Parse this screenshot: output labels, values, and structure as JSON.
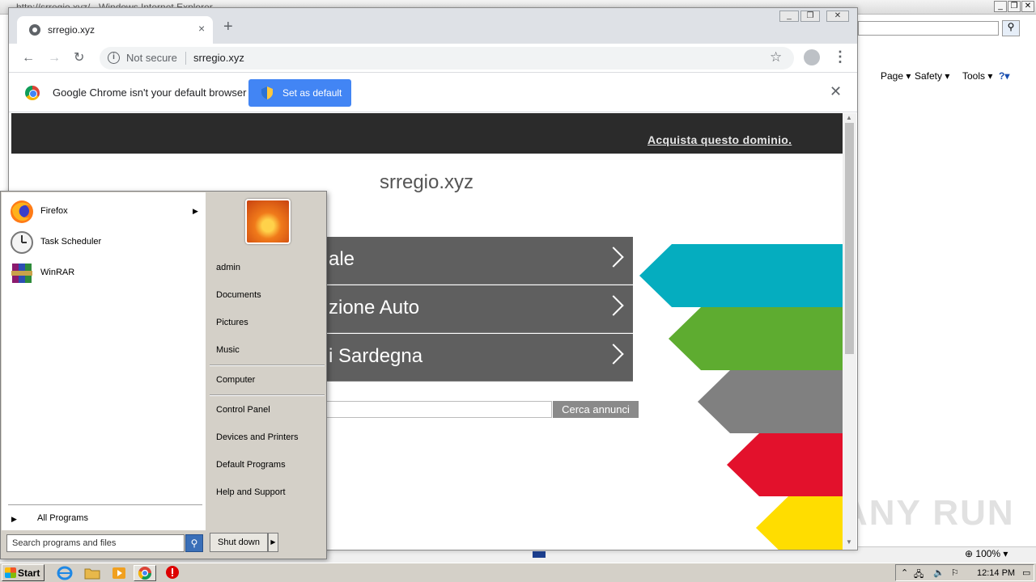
{
  "ie": {
    "title": "http://srregio.xyz/ - Windows Internet Explorer",
    "cmd_page": "Page ▾",
    "cmd_safety": "Safety ▾",
    "cmd_tools": "Tools ▾",
    "zoom": "100%"
  },
  "chrome": {
    "tab_title": "srregio.xyz",
    "tab_close": "×",
    "new_tab": "+",
    "not_secure": "Not secure",
    "url": "srregio.xyz",
    "infobar_message": "Google Chrome isn't your default browser",
    "set_default_label": "Set as default",
    "infobar_close": "✕"
  },
  "page": {
    "buy_domain": "Acquista questo dominio.",
    "site_title": "srregio.xyz",
    "menu": [
      {
        "label": "ale"
      },
      {
        "label": "zione Auto"
      },
      {
        "label": "i Sardegna"
      }
    ],
    "search_button": "Cerca annunci",
    "arrow_colors": [
      "#05adbf",
      "#5eac30",
      "#808080",
      "#e3112c",
      "#ffdd00"
    ]
  },
  "start_menu": {
    "programs": [
      {
        "label": "Firefox",
        "icon": "firefox-icon"
      },
      {
        "label": "Task Scheduler",
        "icon": "clock-icon"
      },
      {
        "label": "WinRAR",
        "icon": "winrar-icon"
      }
    ],
    "all_programs": "All Programs",
    "search_placeholder": "Search programs and files",
    "places": [
      "admin",
      "Documents",
      "Pictures",
      "Music",
      "Computer",
      "Control Panel",
      "Devices and Printers",
      "Default Programs",
      "Help and Support"
    ],
    "shutdown": "Shut down"
  },
  "taskbar": {
    "start_label": "Start",
    "clock": "12:14 PM"
  },
  "watermark": "ANY RUN"
}
